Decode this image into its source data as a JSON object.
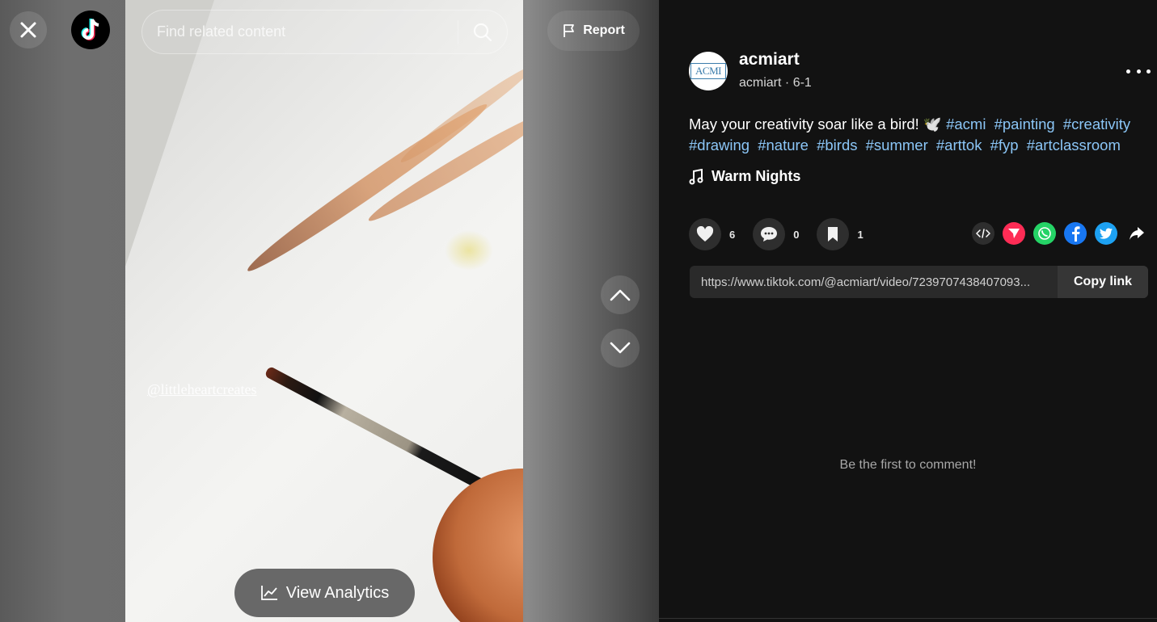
{
  "video": {
    "watermark": "@littleheartcreates"
  },
  "top": {
    "search_placeholder": "Find related content",
    "report_label": "Report"
  },
  "analytics_label": "View Analytics",
  "author": {
    "display_name": "acmiart",
    "handle": "acmiart",
    "separator": "·",
    "date": "6-1",
    "avatar_text": "ACMI"
  },
  "caption": {
    "text": "May your creativity soar like a bird! 🕊️",
    "hashtags": [
      "#acmi",
      "#painting",
      "#creativity",
      "#drawing",
      "#nature",
      "#birds",
      "#summer",
      "#arttok",
      "#fyp",
      "#artclassroom"
    ]
  },
  "music": {
    "title": "Warm Nights",
    "icon": "music-note-icon"
  },
  "stats": {
    "likes": "6",
    "comments": "0",
    "saves": "1"
  },
  "share": {
    "icons": [
      "embed-icon",
      "send-to-friends-icon",
      "whatsapp-icon",
      "facebook-icon",
      "twitter-icon",
      "share-arrow-icon"
    ],
    "colors": {
      "send": "#fe2c55",
      "whatsapp": "#25d366",
      "facebook": "#1877f2",
      "twitter": "#1da1f2"
    }
  },
  "link": {
    "url": "https://www.tiktok.com/@acmiart/video/7239707438407093...",
    "copy_label": "Copy link"
  },
  "comments_empty": "Be the first to comment!",
  "colors": {
    "panel_bg": "#121212",
    "hashtag": "#8bc6f7"
  }
}
